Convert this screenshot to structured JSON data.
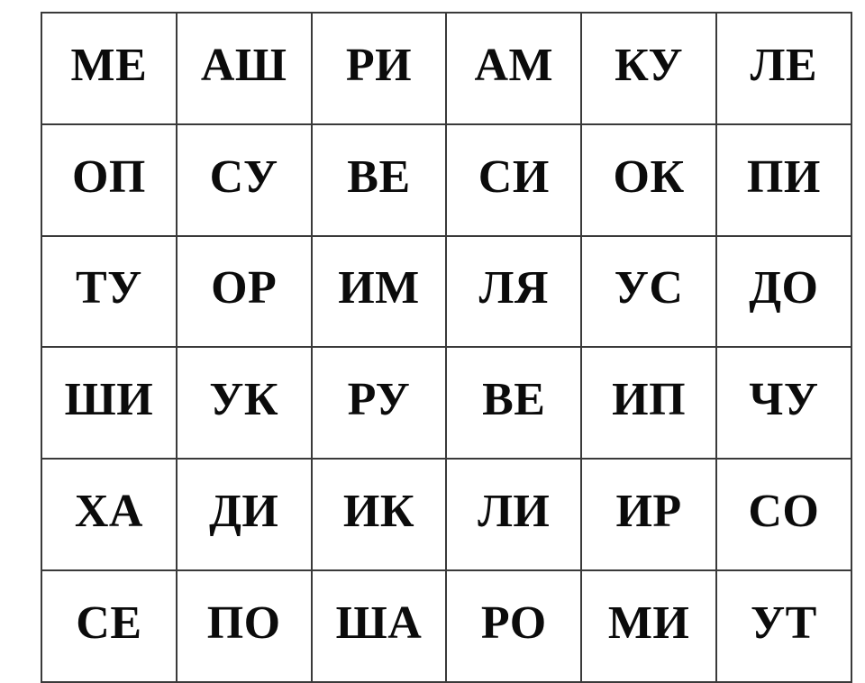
{
  "page": {
    "kind": "syllable-reading-grid",
    "background_color": "#ffffff",
    "border_color": "#3a3a3a",
    "text_color": "#0b0b0b",
    "columns": 6,
    "rows": 6
  },
  "grid": {
    "rows": [
      {
        "cells": [
          "МЕ",
          "АШ",
          "РИ",
          "АМ",
          "КУ",
          "ЛЕ"
        ]
      },
      {
        "cells": [
          "ОП",
          "СУ",
          "ВЕ",
          "СИ",
          "ОК",
          "ПИ"
        ]
      },
      {
        "cells": [
          "ТУ",
          "ОР",
          "ИМ",
          "ЛЯ",
          "УС",
          "ДО"
        ]
      },
      {
        "cells": [
          "ШИ",
          "УК",
          "РУ",
          "ВЕ",
          "ИП",
          "ЧУ"
        ]
      },
      {
        "cells": [
          "ХА",
          "ДИ",
          "ИК",
          "ЛИ",
          "ИР",
          "СО"
        ]
      },
      {
        "cells": [
          "СЕ",
          "ПО",
          "ША",
          "РО",
          "МИ",
          "УТ"
        ]
      }
    ]
  }
}
